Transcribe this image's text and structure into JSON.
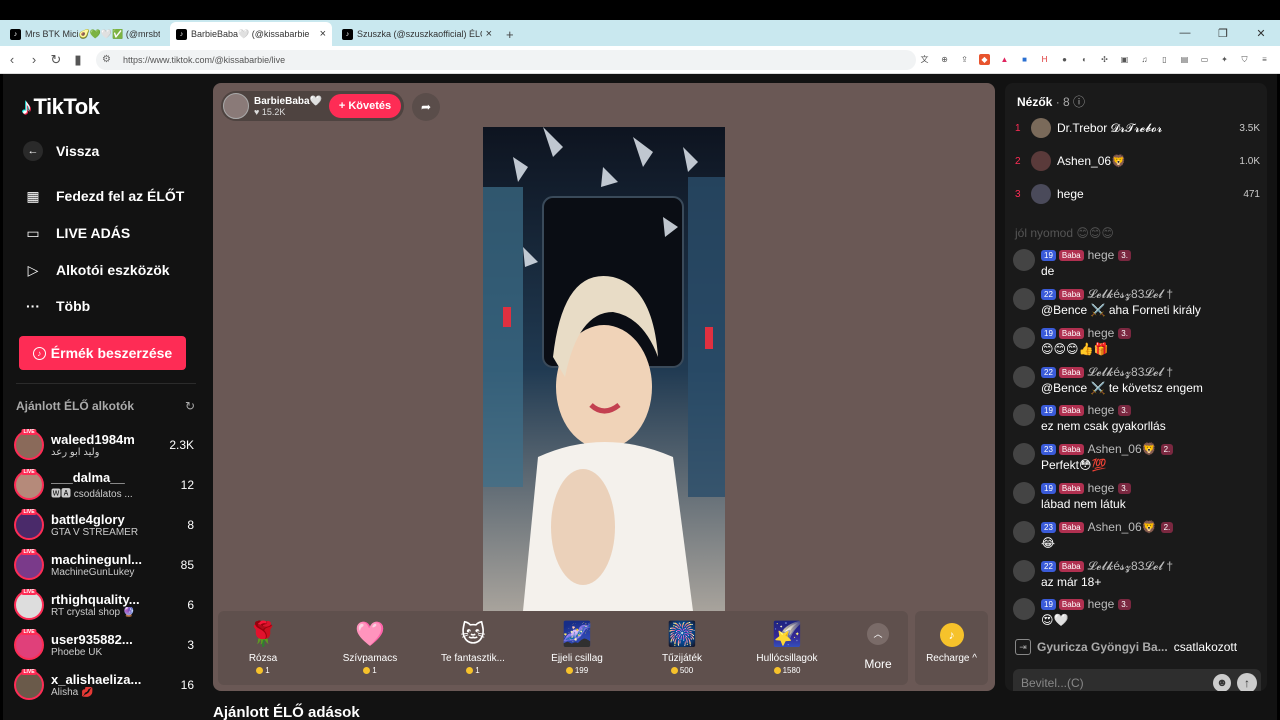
{
  "browser": {
    "tabs": [
      {
        "title": "Mrs BTK Mici🥑💚🤍✅ (@mrsbt"
      },
      {
        "title": "BarbieBaba🤍 (@kissabarbie"
      },
      {
        "title": "Szuszka (@szuszkaofficial) ÉLŐ adás"
      }
    ],
    "new_tab": "+",
    "url": "https://www.tiktok.com/@kissabarbie/live"
  },
  "sidebar": {
    "logo": "TikTok",
    "back": "Vissza",
    "nav": [
      {
        "label": "Fedezd fel az ÉLŐT",
        "icon": "calendar-icon"
      },
      {
        "label": "LIVE ADÁS",
        "icon": "camera-icon"
      },
      {
        "label": "Alkotói eszközök",
        "icon": "creator-tools-icon"
      },
      {
        "label": "Több",
        "icon": "more-dots-icon"
      }
    ],
    "coins_button": "Érmék beszerzése",
    "recommended_title": "Ajánlott ÉLŐ alkotók",
    "live_badge": "LIVE",
    "creators": [
      {
        "name": "waleed1984m",
        "sub": "وليد ابو رعد",
        "count": "2.3K"
      },
      {
        "name": "___dalma__",
        "sub": "🆆🅰 csodálatos ...",
        "count": "12"
      },
      {
        "name": "battle4glory",
        "sub": "GTA V STREAMER",
        "count": "8"
      },
      {
        "name": "machinegunl...",
        "sub": "MachineGunLukey",
        "count": "85"
      },
      {
        "name": "rthighquality...",
        "sub": "RT crystal shop 🔮",
        "count": "6"
      },
      {
        "name": "user935882...",
        "sub": "Phoebe UK",
        "count": "3"
      },
      {
        "name": "x_alishaeliza...",
        "sub": "Alisha 💋",
        "count": "16"
      }
    ]
  },
  "stream": {
    "host_name": "BarbieBaba🤍",
    "likes": "15.2K",
    "follow": "+ Követés",
    "gifts": [
      {
        "name": "Rózsa",
        "icon": "🌹",
        "price": "1"
      },
      {
        "name": "Szívpamacs",
        "icon": "🩷",
        "price": "1"
      },
      {
        "name": "Te fantasztik...",
        "icon": "🐱",
        "price": "1"
      },
      {
        "name": "Éjjeli csillag",
        "icon": "🌌",
        "price": "199"
      },
      {
        "name": "Tűzijáték",
        "icon": "🎆",
        "price": "500"
      },
      {
        "name": "Hullócsillagok",
        "icon": "🌠",
        "price": "1580"
      }
    ],
    "more_label": "More",
    "recharge_label": "Recharge ^",
    "featured_title": "Ajánlott ÉLŐ adások"
  },
  "chat": {
    "viewers_label": "Nézők",
    "viewers_count": "· 8",
    "top_viewers": [
      {
        "rank": "1",
        "name": "Dr.Trebor 𝓓𝓻𝓣𝓻𝓮𝓫𝓸𝓻",
        "score": "3.5K"
      },
      {
        "rank": "2",
        "name": "Ashen_06🦁",
        "score": "1.0K"
      },
      {
        "rank": "3",
        "name": "hege",
        "score": "471"
      }
    ],
    "faded_text": "jól nyomod 😊😊😊",
    "messages": [
      {
        "level": "19",
        "fan": "Baba",
        "user": "hege",
        "rank": "3.",
        "text": "de"
      },
      {
        "level": "22",
        "fan": "Baba",
        "user": "𝓛𝓮𝓵𝓴é𝓼𝔃83𝓛𝓮𝓵 †",
        "rank": "",
        "text": "@Bence ⚔️ aha Forneti király"
      },
      {
        "level": "19",
        "fan": "Baba",
        "user": "hege",
        "rank": "3.",
        "text": "😊😊😊👍🎁"
      },
      {
        "level": "22",
        "fan": "Baba",
        "user": "𝓛𝓮𝓵𝓴é𝓼𝔃83𝓛𝓮𝓵 †",
        "rank": "",
        "text": "@Bence ⚔️ te követsz engem"
      },
      {
        "level": "19",
        "fan": "Baba",
        "user": "hege",
        "rank": "3.",
        "text": "ez nem csak gyakorllás"
      },
      {
        "level": "23",
        "fan": "Baba",
        "user": "Ashen_06🦁",
        "rank": "2.",
        "text": "Perfekt😳💯"
      },
      {
        "level": "19",
        "fan": "Baba",
        "user": "hege",
        "rank": "3.",
        "text": "lábad nem látuk"
      },
      {
        "level": "23",
        "fan": "Baba",
        "user": "Ashen_06🦁",
        "rank": "2.",
        "text": "😂"
      },
      {
        "level": "22",
        "fan": "Baba",
        "user": "𝓛𝓮𝓵𝓴é𝓼𝔃83𝓛𝓮𝓵 †",
        "rank": "",
        "text": "az már 18+"
      },
      {
        "level": "19",
        "fan": "Baba",
        "user": "hege",
        "rank": "3.",
        "text": "😍🤍"
      }
    ],
    "joined_user": "Gyuricza Gyöngyi Ba...",
    "joined_text": "csatlakozott",
    "input_placeholder": "Bevitel...(C)"
  },
  "colors": {
    "accent": "#fe2c55",
    "coin": "#f6c22b",
    "stage_bg": "#6a5855"
  }
}
